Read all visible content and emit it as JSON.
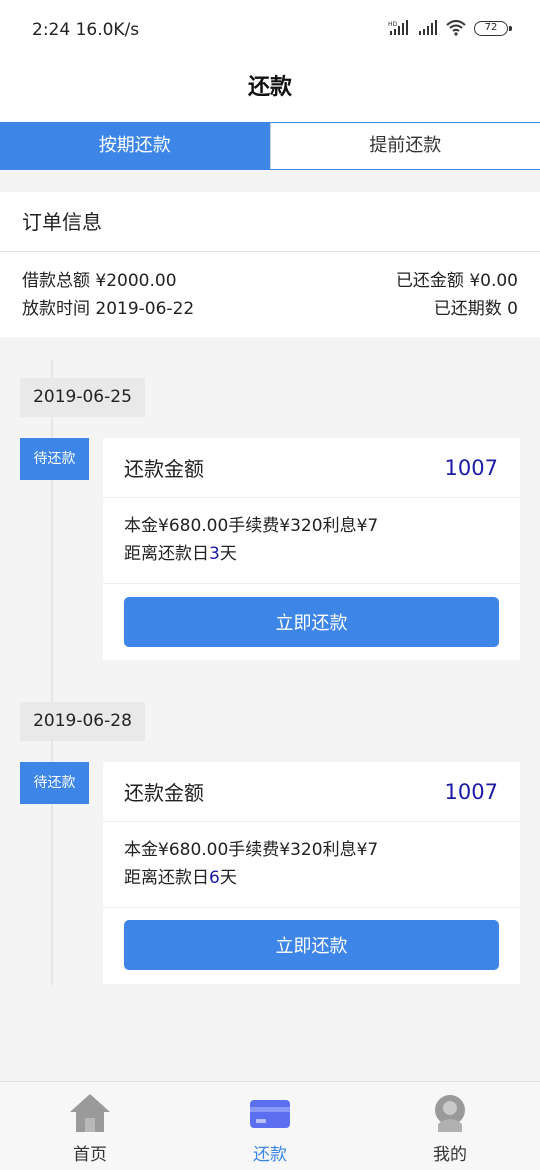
{
  "status_bar": {
    "time": "2:24 16.0K/s",
    "battery": "72"
  },
  "header": {
    "title": "还款"
  },
  "tabs": [
    {
      "label": "按期还款",
      "active": true
    },
    {
      "label": "提前还款",
      "active": false
    }
  ],
  "order": {
    "title": "订单信息",
    "total_label": "借款总额 ¥2000.00",
    "repaid_label": "已还金额 ¥0.00",
    "release_label": "放款时间 2019-06-22",
    "periods_label": "已还期数 0"
  },
  "installments": [
    {
      "date": "2019-06-25",
      "status": "待还款",
      "amount_label": "还款金额",
      "amount": "1007",
      "breakdown": "本金¥680.00手续费¥320利息¥7",
      "days_prefix": "距离还款日",
      "days": "3",
      "days_suffix": "天",
      "button": "立即还款"
    },
    {
      "date": "2019-06-28",
      "status": "待还款",
      "amount_label": "还款金额",
      "amount": "1007",
      "breakdown": "本金¥680.00手续费¥320利息¥7",
      "days_prefix": "距离还款日",
      "days": "6",
      "days_suffix": "天",
      "button": "立即还款"
    }
  ],
  "bottom_nav": [
    {
      "label": "首页",
      "icon": "home-icon",
      "active": false
    },
    {
      "label": "还款",
      "icon": "card-icon",
      "active": true
    },
    {
      "label": "我的",
      "icon": "user-icon",
      "active": false
    }
  ],
  "colors": {
    "accent": "#3d86e8",
    "amount": "#1a1aa6"
  }
}
